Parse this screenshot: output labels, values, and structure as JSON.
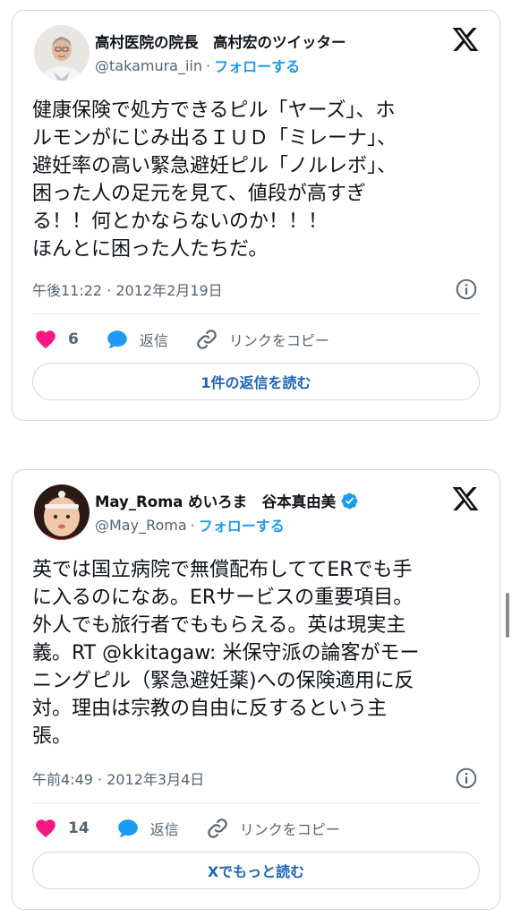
{
  "tweets": [
    {
      "display_name": "高村医院の院長　高村宏のツイッター",
      "handle": "@takamura_iin",
      "separator": "·",
      "follow_label": "フォローする",
      "verified": false,
      "body_lines": [
        "健康保険で処方できるピル「ヤーズ」、ホ",
        "ルモンがにじみ出るＩＵＤ「ミレーナ」、",
        "避妊率の高い緊急避妊ピル「ノルレボ」、",
        "困った人の足元を見て、値段が高すぎ",
        "る！！何とかならないのか！！！",
        "ほんとに困った人たちだ。"
      ],
      "timestamp": "午後11:22 · 2012年2月19日",
      "like_count": "6",
      "reply_label": "返信",
      "copy_link_label": "リンクをコピー",
      "read_button": "1件の返信を読む"
    },
    {
      "display_name": "May_Roma めいろま　谷本真由美",
      "handle": "@May_Roma",
      "separator": "·",
      "follow_label": "フォローする",
      "verified": true,
      "body_lines": [
        "英では国立病院で無償配布しててERでも手",
        "に入るのになあ。ERサービスの重要項目。",
        "外人でも旅行者でももらえる。英は現実主",
        "義。RT @kkitagaw: 米保守派の論客がモー",
        "ニングピル（緊急避妊薬)への保険適用に反",
        "対。理由は宗教の自由に反するという主",
        "張。"
      ],
      "timestamp": "午前4:49 · 2012年3月4日",
      "like_count": "14",
      "reply_label": "返信",
      "copy_link_label": "リンクをコピー",
      "read_button": "Xでもっと読む"
    }
  ],
  "icons": {
    "logo": "x-logo-icon",
    "verified": "verified-badge-icon",
    "info": "info-icon",
    "like": "heart-icon",
    "reply": "reply-bubble-icon",
    "copy": "link-icon"
  },
  "colors": {
    "accent": "#1d9bf0",
    "like": "#f91880",
    "secondary_text": "#536471",
    "border": "#cfd9de"
  }
}
